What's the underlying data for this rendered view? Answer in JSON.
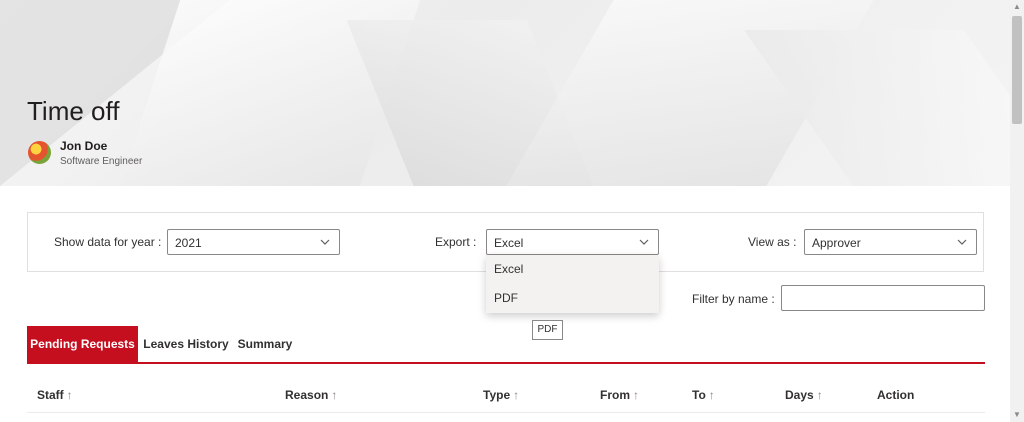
{
  "header": {
    "title": "Time off",
    "user": {
      "name": "Jon Doe",
      "role": "Software Engineer"
    }
  },
  "filters": {
    "year_label": "Show data for year :",
    "year_value": "2021",
    "export_label": "Export :",
    "export_value": "Excel",
    "view_label": "View as :",
    "view_value": "Approver",
    "filter_name_label": "Filter by name :",
    "filter_name_value": ""
  },
  "export_menu": {
    "options": [
      "Excel",
      "PDF"
    ],
    "tooltip": "PDF"
  },
  "tabs": [
    {
      "label": "Pending Requests",
      "active": true
    },
    {
      "label": "Leaves History",
      "active": false
    },
    {
      "label": "Summary",
      "active": false
    }
  ],
  "table": {
    "columns": [
      {
        "label": "Staff",
        "sort": "↑"
      },
      {
        "label": "Reason",
        "sort": "↑"
      },
      {
        "label": "Type",
        "sort": "↑"
      },
      {
        "label": "From",
        "sort": "↑"
      },
      {
        "label": "To",
        "sort": "↑"
      },
      {
        "label": "Days",
        "sort": "↑"
      },
      {
        "label": "Action",
        "sort": ""
      }
    ]
  },
  "colors": {
    "accent": "#c50f1f"
  },
  "icons": {
    "dropdown": "chevron-down-icon",
    "scroll_up": "arrow-up-icon",
    "scroll_down": "arrow-down-icon"
  }
}
